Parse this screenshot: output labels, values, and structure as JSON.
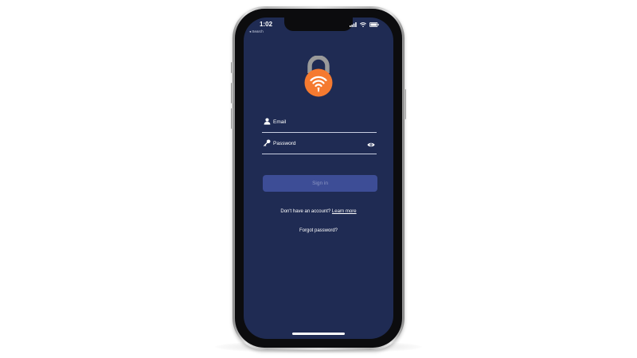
{
  "status_bar": {
    "time": "1:02",
    "back_link": "◂ Search",
    "icons": [
      "signal-icon",
      "wifi-icon",
      "battery-icon"
    ]
  },
  "logo": {
    "icon": "padlock-wifi-icon",
    "colors": {
      "shackle": "#9a9a9a",
      "body": "#f57a30",
      "symbol": "#ffffff"
    }
  },
  "form": {
    "email": {
      "placeholder": "Email",
      "value": "",
      "icon": "user-icon"
    },
    "password": {
      "placeholder": "Password",
      "value": "",
      "icon": "key-icon",
      "toggle_icon": "eye-icon"
    },
    "submit_label": "Sign in"
  },
  "signup": {
    "prompt": "Don't have an account?",
    "link": "Learn more"
  },
  "forgot_password": "Forgot password?",
  "colors": {
    "screen_background": "#1f2b53",
    "button_background": "#3d4d96",
    "button_text": "#8d97c4",
    "accent": "#f57a30"
  }
}
